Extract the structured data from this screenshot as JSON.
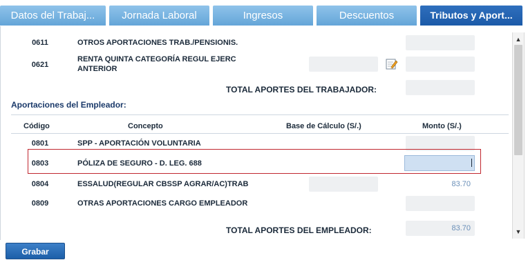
{
  "tabs": [
    {
      "label": "Datos del Trabaj..."
    },
    {
      "label": "Jornada Laboral"
    },
    {
      "label": "Ingresos"
    },
    {
      "label": "Descuentos"
    },
    {
      "label": "Tributos y Aport..."
    }
  ],
  "worker_section": {
    "rows": [
      {
        "code": "0611",
        "concept": "OTROS APORTACIONES TRAB./PENSIONIS."
      },
      {
        "code": "0621",
        "concept_line1": "RENTA QUINTA CATEGORÍA REGUL EJERC",
        "concept_line2": "ANTERIOR"
      }
    ],
    "total_label": "TOTAL APORTES DEL TRABAJADOR:"
  },
  "employer_section": {
    "title": "Aportaciones del Empleador:",
    "columns": {
      "code": "Código",
      "concept": "Concepto",
      "base": "Base de Cálculo (S/.)",
      "amount": "Monto (S/.)"
    },
    "rows": [
      {
        "code": "0801",
        "concept": "SPP - APORTACIÓN VOLUNTARIA",
        "amount": ""
      },
      {
        "code": "0803",
        "concept": "PÓLIZA DE SEGURO - D. LEG. 688",
        "amount": ""
      },
      {
        "code": "0804",
        "concept": "ESSALUD(REGULAR CBSSP AGRAR/AC)TRAB",
        "amount": "83.70"
      },
      {
        "code": "0809",
        "concept": "OTRAS APORTACIONES CARGO EMPLEADOR",
        "amount": ""
      }
    ],
    "total_label": "TOTAL APORTES DEL EMPLEADOR:",
    "total_amount": "83.70"
  },
  "actions": {
    "save_label": "Grabar"
  },
  "icons": {
    "edit": "edit-pencil-icon",
    "scroll_up": "scroll-up-arrow-icon",
    "scroll_down": "scroll-down-arrow-icon"
  }
}
